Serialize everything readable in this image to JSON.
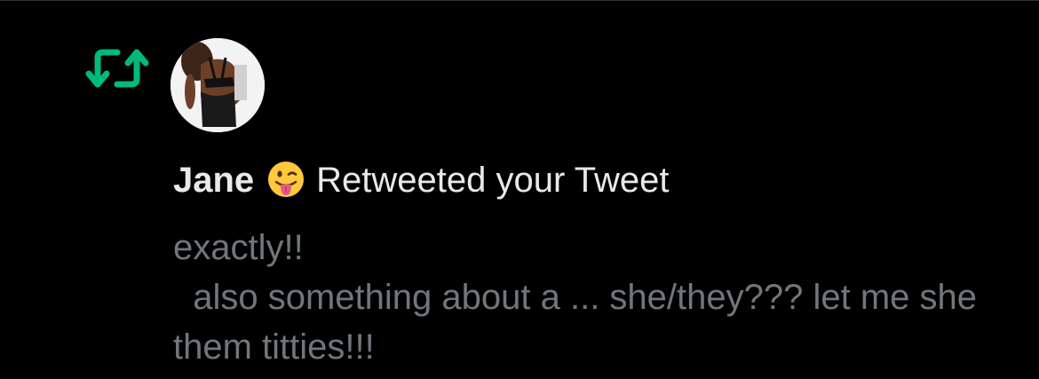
{
  "notification": {
    "type_icon": "retweet-icon",
    "accent_color": "#00ba7c",
    "avatar": "user-avatar-photo",
    "user_name": "Jane",
    "name_emoji": "face-with-tongue-emoji",
    "action_text": "Retweeted your Tweet",
    "tweet_text": "exactly!!\n  also something about a ... she/they??? let me she them titties!!!"
  }
}
